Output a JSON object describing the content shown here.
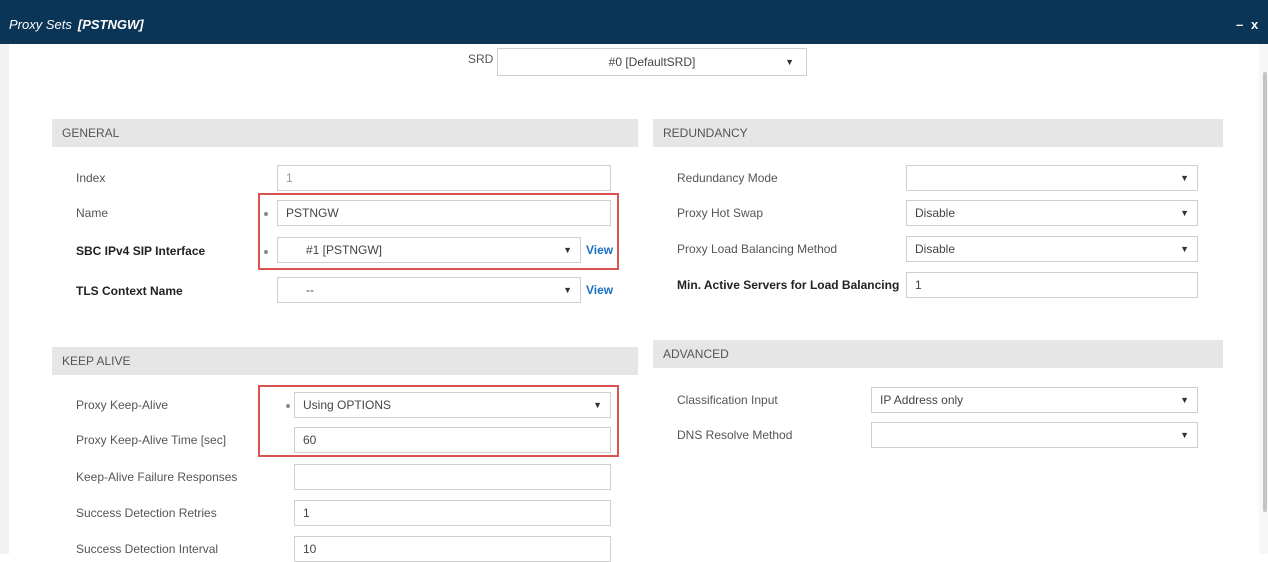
{
  "window": {
    "title": "Proxy Sets",
    "subtitle": "[PSTNGW]",
    "minimize": "–",
    "close": "x"
  },
  "srd": {
    "label": "SRD",
    "value": "#0 [DefaultSRD]"
  },
  "general": {
    "header": "GENERAL",
    "index": {
      "label": "Index",
      "value": "1"
    },
    "name": {
      "label": "Name",
      "value": "PSTNGW"
    },
    "sip_interface": {
      "label": "SBC IPv4 SIP Interface",
      "value": "#1 [PSTNGW]",
      "link": "View"
    },
    "tls_context": {
      "label": "TLS Context Name",
      "value": "--",
      "link": "View"
    }
  },
  "keep_alive": {
    "header": "KEEP ALIVE",
    "proxy_keep_alive": {
      "label": "Proxy Keep-Alive",
      "value": "Using OPTIONS"
    },
    "keep_alive_time": {
      "label": "Proxy Keep-Alive Time [sec]",
      "value": "60"
    },
    "failure_responses": {
      "label": "Keep-Alive Failure Responses",
      "value": ""
    },
    "success_retries": {
      "label": "Success Detection Retries",
      "value": "1"
    },
    "success_interval": {
      "label": "Success Detection Interval",
      "value": "10"
    }
  },
  "redundancy": {
    "header": "REDUNDANCY",
    "mode": {
      "label": "Redundancy Mode",
      "value": ""
    },
    "hot_swap": {
      "label": "Proxy Hot Swap",
      "value": "Disable"
    },
    "load_balancing": {
      "label": "Proxy Load Balancing Method",
      "value": "Disable"
    },
    "min_active": {
      "label": "Min. Active Servers for Load Balancing",
      "value": "1"
    }
  },
  "advanced": {
    "header": "ADVANCED",
    "classification": {
      "label": "Classification Input",
      "value": "IP Address only"
    },
    "dns_method": {
      "label": "DNS Resolve Method",
      "value": ""
    }
  },
  "icons": {
    "dropdown": "▼"
  },
  "colors": {
    "titlebar": "#0b3557",
    "highlight": "#d9534f",
    "link": "#1a6fc0",
    "section_bg": "#e6e6e6"
  }
}
